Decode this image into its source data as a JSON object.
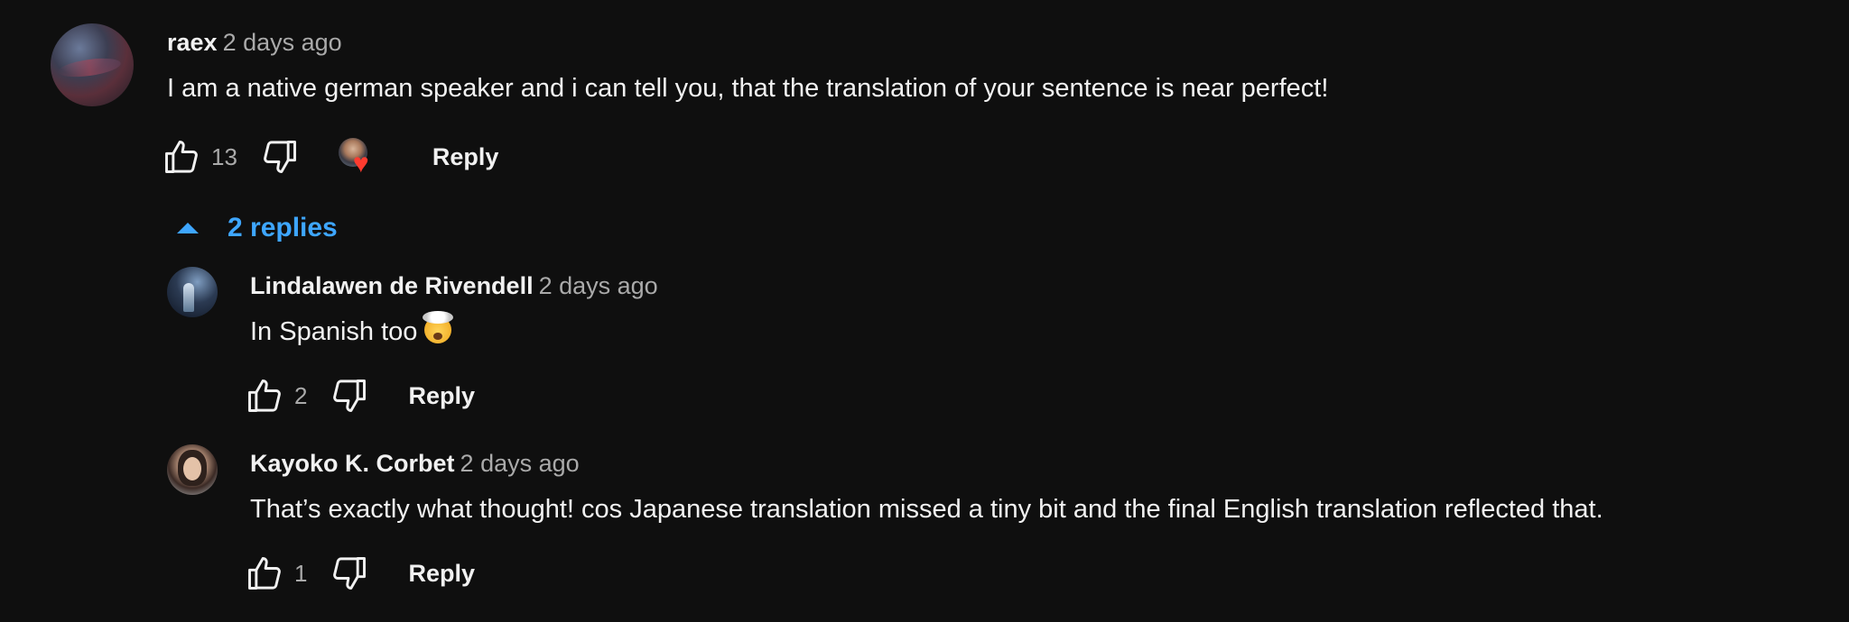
{
  "comments": [
    {
      "author": "raex",
      "time": "2 days ago",
      "text": "I am a native german speaker and i can tell you, that the translation of your sentence is near perfect!",
      "likes": "13",
      "reply_label": "Reply",
      "hearted_by_creator": true
    }
  ],
  "replies_toggle": {
    "label": "2 replies",
    "icon": "caret-up-icon",
    "color": "#3ea6ff"
  },
  "replies": [
    {
      "author": "Lindalawen de Rivendell",
      "time": "2 days ago",
      "text": "In Spanish too",
      "emoji": "exploding-head",
      "likes": "2",
      "reply_label": "Reply"
    },
    {
      "author": "Kayoko K. Corbet",
      "time": "2 days ago",
      "text": "That’s exactly what thought! cos Japanese translation missed a tiny bit and the final English translation reflected that.",
      "likes": "1",
      "reply_label": "Reply"
    }
  ],
  "icons": {
    "like": "thumbs-up-icon",
    "dislike": "thumbs-down-icon",
    "heart": "heart-icon"
  },
  "colors": {
    "background": "#0f0f0f",
    "text": "#f1f1f1",
    "secondary_text": "#aaaaaa",
    "heart": "#ff3b2f"
  }
}
